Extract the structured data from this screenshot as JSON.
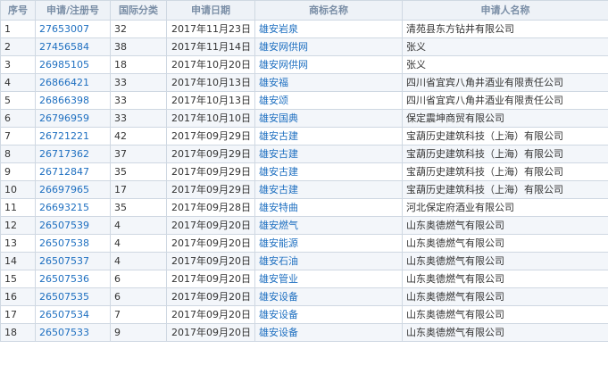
{
  "headers": [
    "序号",
    "申请/注册号",
    "国际分类",
    "申请日期",
    "商标名称",
    "申请人名称"
  ],
  "rows": [
    {
      "no": "1",
      "reg": "27653007",
      "cls": "32",
      "date": "2017年11月23日",
      "mark": "雄安岩泉",
      "applicant": "清苑县东方钻井有限公司"
    },
    {
      "no": "2",
      "reg": "27456584",
      "cls": "38",
      "date": "2017年11月14日",
      "mark": "雄安网供网",
      "applicant": "张义"
    },
    {
      "no": "3",
      "reg": "26985105",
      "cls": "18",
      "date": "2017年10月20日",
      "mark": "雄安网供网",
      "applicant": "张义"
    },
    {
      "no": "4",
      "reg": "26866421",
      "cls": "33",
      "date": "2017年10月13日",
      "mark": "雄安福",
      "applicant": "四川省宜宾八角井酒业有限责任公司"
    },
    {
      "no": "5",
      "reg": "26866398",
      "cls": "33",
      "date": "2017年10月13日",
      "mark": "雄安颂",
      "applicant": "四川省宜宾八角井酒业有限责任公司"
    },
    {
      "no": "6",
      "reg": "26796959",
      "cls": "33",
      "date": "2017年10月10日",
      "mark": "雄安国典",
      "applicant": "保定震坤商贸有限公司"
    },
    {
      "no": "7",
      "reg": "26721221",
      "cls": "42",
      "date": "2017年09月29日",
      "mark": "雄安古建",
      "applicant": "宝葫历史建筑科技（上海）有限公司"
    },
    {
      "no": "8",
      "reg": "26717362",
      "cls": "37",
      "date": "2017年09月29日",
      "mark": "雄安古建",
      "applicant": "宝葫历史建筑科技（上海）有限公司"
    },
    {
      "no": "9",
      "reg": "26712847",
      "cls": "35",
      "date": "2017年09月29日",
      "mark": "雄安古建",
      "applicant": "宝葫历史建筑科技（上海）有限公司"
    },
    {
      "no": "10",
      "reg": "26697965",
      "cls": "17",
      "date": "2017年09月29日",
      "mark": "雄安古建",
      "applicant": "宝葫历史建筑科技（上海）有限公司"
    },
    {
      "no": "11",
      "reg": "26693215",
      "cls": "35",
      "date": "2017年09月28日",
      "mark": "雄安特曲",
      "applicant": "河北保定府酒业有限公司"
    },
    {
      "no": "12",
      "reg": "26507539",
      "cls": "4",
      "date": "2017年09月20日",
      "mark": "雄安燃气",
      "applicant": "山东奥德燃气有限公司"
    },
    {
      "no": "13",
      "reg": "26507538",
      "cls": "4",
      "date": "2017年09月20日",
      "mark": "雄安能源",
      "applicant": "山东奥德燃气有限公司"
    },
    {
      "no": "14",
      "reg": "26507537",
      "cls": "4",
      "date": "2017年09月20日",
      "mark": "雄安石油",
      "applicant": "山东奥德燃气有限公司"
    },
    {
      "no": "15",
      "reg": "26507536",
      "cls": "6",
      "date": "2017年09月20日",
      "mark": "雄安管业",
      "applicant": "山东奥德燃气有限公司"
    },
    {
      "no": "16",
      "reg": "26507535",
      "cls": "6",
      "date": "2017年09月20日",
      "mark": "雄安设备",
      "applicant": "山东奥德燃气有限公司"
    },
    {
      "no": "17",
      "reg": "26507534",
      "cls": "7",
      "date": "2017年09月20日",
      "mark": "雄安设备",
      "applicant": "山东奥德燃气有限公司"
    },
    {
      "no": "18",
      "reg": "26507533",
      "cls": "9",
      "date": "2017年09月20日",
      "mark": "雄安设备",
      "applicant": "山东奥德燃气有限公司"
    }
  ]
}
